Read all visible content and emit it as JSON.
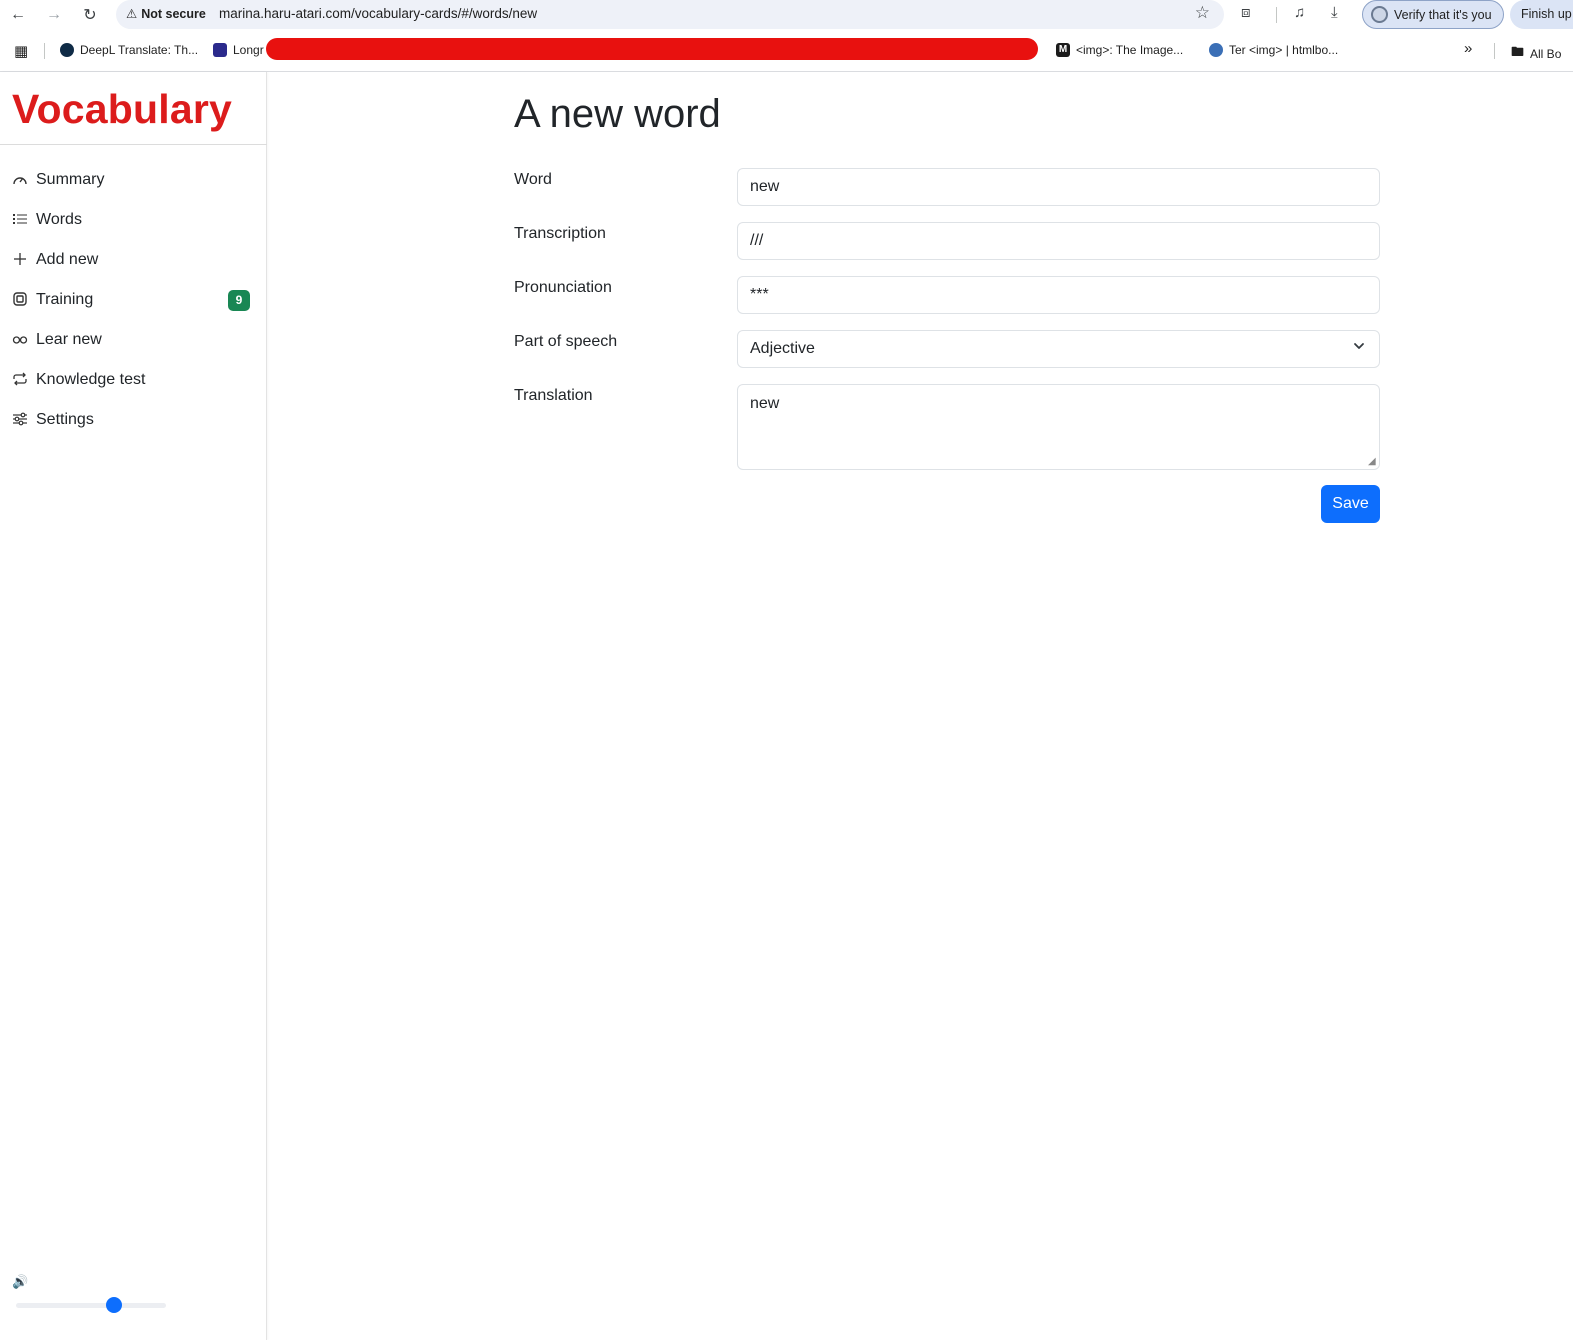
{
  "browser": {
    "security_label": "Not secure",
    "url": "marina.haru-atari.com/vocabulary-cards/#/words/new",
    "verify_label": "Verify that it's you",
    "finish_label": "Finish up",
    "bookmarks": [
      {
        "label": "DeepL Translate: Th...",
        "icon": "deepl-icon",
        "color": "#0f2b46"
      },
      {
        "label": "Longr",
        "icon": "longman-icon",
        "color": "#2b2a8c"
      },
      {
        "label": "<img>: The Image...",
        "icon": "mdn-icon",
        "color": "#1b1b1b"
      },
      {
        "label": "Ter <img> | htmlbo...",
        "icon": "htmlbook-icon",
        "color": "#3b6fb6"
      }
    ],
    "all_bookmarks_label": "All Bo"
  },
  "sidebar": {
    "brand": "Vocabulary",
    "brand_color": "#dc1c1c",
    "items": [
      {
        "label": "Summary",
        "icon": "dashboard-icon"
      },
      {
        "label": "Words",
        "icon": "list-icon"
      },
      {
        "label": "Add new",
        "icon": "plus-icon"
      },
      {
        "label": "Training",
        "icon": "training-icon",
        "badge": "9"
      },
      {
        "label": "Lear new",
        "icon": "infinity-icon"
      },
      {
        "label": "Knowledge test",
        "icon": "repeat-icon"
      },
      {
        "label": "Settings",
        "icon": "sliders-icon"
      }
    ],
    "volume": {
      "icon": "volume-icon",
      "level": 0.65
    }
  },
  "form": {
    "title": "A new word",
    "fields": {
      "word": {
        "label": "Word",
        "value": "new"
      },
      "transcription": {
        "label": "Transcription",
        "value": "///"
      },
      "pronunciation": {
        "label": "Pronunciation",
        "value": "***"
      },
      "part_of_speech": {
        "label": "Part of speech",
        "value": "Adjective"
      },
      "translation": {
        "label": "Translation",
        "value": "new"
      }
    },
    "save_label": "Save",
    "accent_color": "#0d6efd",
    "badge_color": "#198754"
  }
}
